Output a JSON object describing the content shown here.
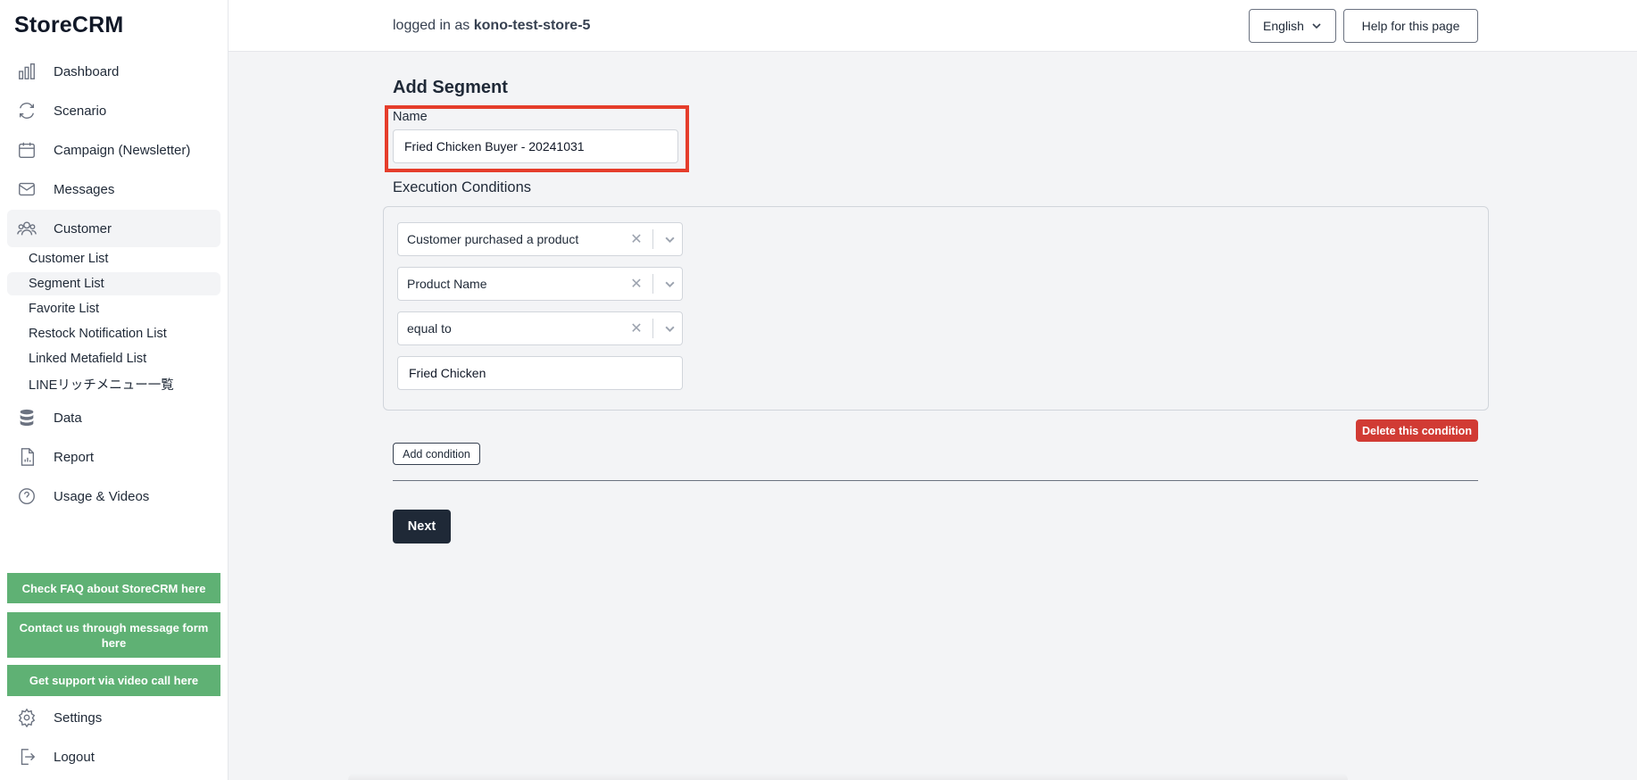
{
  "app": {
    "logo": "StoreCRM"
  },
  "sidebar": {
    "items": [
      {
        "label": "Dashboard",
        "icon": "bar-chart-icon"
      },
      {
        "label": "Scenario",
        "icon": "refresh-icon"
      },
      {
        "label": "Campaign (Newsletter)",
        "icon": "calendar-icon"
      },
      {
        "label": "Messages",
        "icon": "envelope-icon"
      },
      {
        "label": "Customer",
        "icon": "users-icon"
      },
      {
        "label": "Data",
        "icon": "database-icon"
      },
      {
        "label": "Report",
        "icon": "report-icon"
      },
      {
        "label": "Usage & Videos",
        "icon": "question-icon"
      }
    ],
    "customer_sub": [
      {
        "label": "Customer List"
      },
      {
        "label": "Segment List"
      },
      {
        "label": "Favorite List"
      },
      {
        "label": "Restock Notification List"
      },
      {
        "label": "Linked Metafield List"
      },
      {
        "label": "LINEリッチメニュー一覧"
      }
    ],
    "support_buttons": [
      {
        "label": "Check FAQ about StoreCRM here"
      },
      {
        "label": "Contact us through message form here"
      },
      {
        "label": "Get support via video call here"
      }
    ],
    "bottom": [
      {
        "label": "Settings",
        "icon": "gear-icon"
      },
      {
        "label": "Logout",
        "icon": "logout-icon"
      }
    ],
    "active_item": "Customer",
    "active_sub": "Segment List",
    "support_color": "#5fb174"
  },
  "header": {
    "login_prefix": "logged in as",
    "username": "kono-test-store-5",
    "language": "English",
    "help_label": "Help for this page"
  },
  "main": {
    "title": "Add Segment",
    "name_label": "Name",
    "name_value": "Fried Chicken Buyer - 20241031",
    "exec_label": "Execution Conditions",
    "conditions": [
      {
        "value": "Customer purchased a product"
      },
      {
        "value": "Product Name"
      },
      {
        "value": "equal to"
      }
    ],
    "condition_text": "Fried Chicken",
    "delete_label": "Delete this condition",
    "add_label": "Add condition",
    "next_label": "Next",
    "accent_colors": {
      "delete": "#d13b34",
      "highlight": "#e53d2b",
      "next": "#1f2937"
    }
  }
}
